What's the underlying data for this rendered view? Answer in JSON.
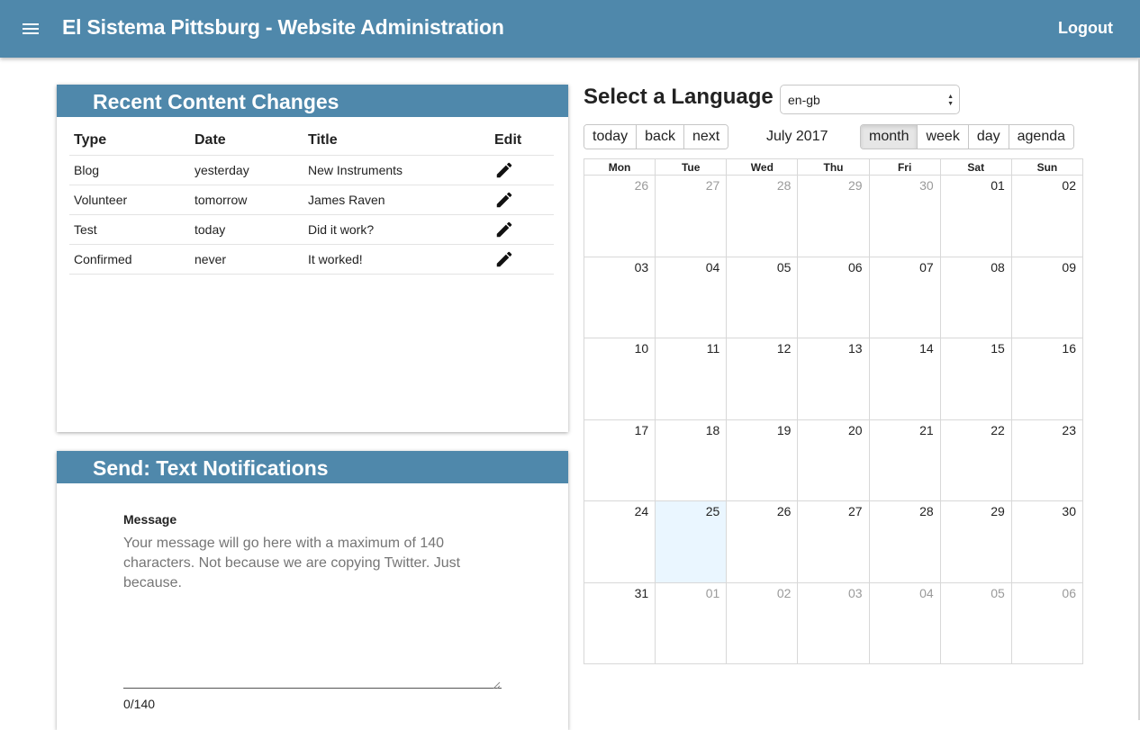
{
  "app": {
    "title": "El Sistema Pittsburg - Website Administration",
    "logout_label": "Logout"
  },
  "recent": {
    "title": "Recent Content Changes",
    "headers": [
      "Type",
      "Date",
      "Title",
      "Edit"
    ],
    "rows": [
      {
        "type": "Blog",
        "date": "yesterday",
        "title": "New Instruments"
      },
      {
        "type": "Volunteer",
        "date": "tomorrow",
        "title": "James Raven"
      },
      {
        "type": "Test",
        "date": "today",
        "title": "Did it work?"
      },
      {
        "type": "Confirmed",
        "date": "never",
        "title": "It worked!"
      }
    ],
    "edit_icon": "pencil-icon"
  },
  "sms": {
    "title": "Send: Text Notifications",
    "message_label": "Message",
    "message_placeholder": "Your message will go here with a maximum of 140 characters. Not because we are copying Twitter. Just because.",
    "counter": "0/140"
  },
  "language": {
    "label": "Select a Language",
    "selected": "en-gb"
  },
  "calendar": {
    "nav": [
      "today",
      "back",
      "next"
    ],
    "label": "July 2017",
    "views": [
      "month",
      "week",
      "day",
      "agenda"
    ],
    "active_view": "month",
    "weekdays": [
      "Mon",
      "Tue",
      "Wed",
      "Thu",
      "Fri",
      "Sat",
      "Sun"
    ],
    "weeks": [
      [
        "26",
        "27",
        "28",
        "29",
        "30",
        "01",
        "02"
      ],
      [
        "03",
        "04",
        "05",
        "06",
        "07",
        "08",
        "09"
      ],
      [
        "10",
        "11",
        "12",
        "13",
        "14",
        "15",
        "16"
      ],
      [
        "17",
        "18",
        "19",
        "20",
        "21",
        "22",
        "23"
      ],
      [
        "24",
        "25",
        "26",
        "27",
        "28",
        "29",
        "30"
      ],
      [
        "31",
        "01",
        "02",
        "03",
        "04",
        "05",
        "06"
      ]
    ],
    "today_date": "25"
  },
  "colors": {
    "header_bar": "#4f88ab",
    "today_highlight": "#eaf6ff"
  }
}
